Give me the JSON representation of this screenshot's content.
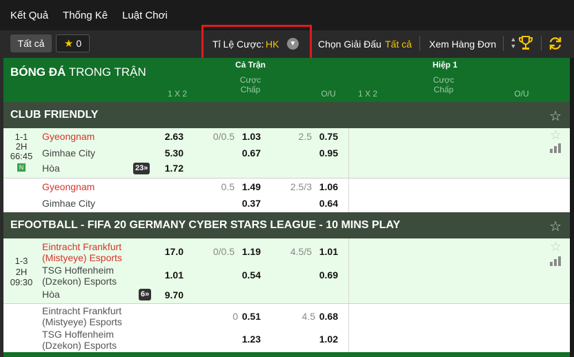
{
  "nav": {
    "items": [
      "Kết Quả",
      "Thống Kê",
      "Luật Chơi"
    ]
  },
  "toolbar": {
    "all_label": "Tất cả",
    "fav_count": "0",
    "odds_label": "Tỉ Lệ Cược:",
    "odds_value": "HK",
    "league_label": "Chọn Giải Đấu",
    "league_value": "Tất cả",
    "single_view": "Xem Hàng Đơn"
  },
  "header": {
    "sport_bold": "BÓNG ĐÁ",
    "sport_rest": " TRONG TRẬN",
    "full_match": "Cả Trận",
    "half1": "Hiệp 1",
    "col_1x2": "1 X 2",
    "col_hcap_line1": "Cược",
    "col_hcap_line2": "Chấp",
    "col_ou": "O/U"
  },
  "leagues": [
    {
      "name": "CLUB FRIENDLY",
      "match": {
        "score": "1-1",
        "period": "2H",
        "time": "66:45",
        "badge": "N",
        "home": "Gyeongnam",
        "away": "Gimhae City",
        "draw": "Hòa",
        "more": "23",
        "main": {
          "o1": "2.63",
          "o2": "5.30",
          "ox": "1.72",
          "hcap": "0/0.5",
          "h1": "1.03",
          "h2": "0.67",
          "ou": "2.5",
          "ou1": "0.75",
          "ou2": "0.95"
        },
        "alt": {
          "home": "Gyeongnam",
          "away": "Gimhae City",
          "hcap": "0.5",
          "h1": "1.49",
          "h2": "0.37",
          "ou": "2.5/3",
          "ou1": "1.06",
          "ou2": "0.64"
        }
      }
    },
    {
      "name": "EFOOTBALL - FIFA 20 GERMANY CYBER STARS LEAGUE - 10 MINS PLAY",
      "match": {
        "score": "1-3",
        "period": "2H",
        "time": "09:30",
        "home1": "Eintracht Frankfurt",
        "home2": "(Mistyeye) Esports",
        "away1": "TSG Hoffenheim",
        "away2": "(Dzekon) Esports",
        "draw": "Hòa",
        "more": "6",
        "main": {
          "o1": "17.0",
          "o2": "1.01",
          "ox": "9.70",
          "hcap": "0/0.5",
          "h1": "1.19",
          "h2": "0.54",
          "ou": "4.5/5",
          "ou1": "1.01",
          "ou2": "0.69"
        },
        "alt": {
          "home1": "Eintracht Frankfurt",
          "home2": "(Mistyeye) Esports",
          "away1": "TSG Hoffenheim",
          "away2": "(Dzekon) Esports",
          "hcap": "0",
          "h1": "0.51",
          "h2": "1.23",
          "ou": "4.5",
          "ou1": "0.68",
          "ou2": "1.02"
        }
      }
    }
  ]
}
